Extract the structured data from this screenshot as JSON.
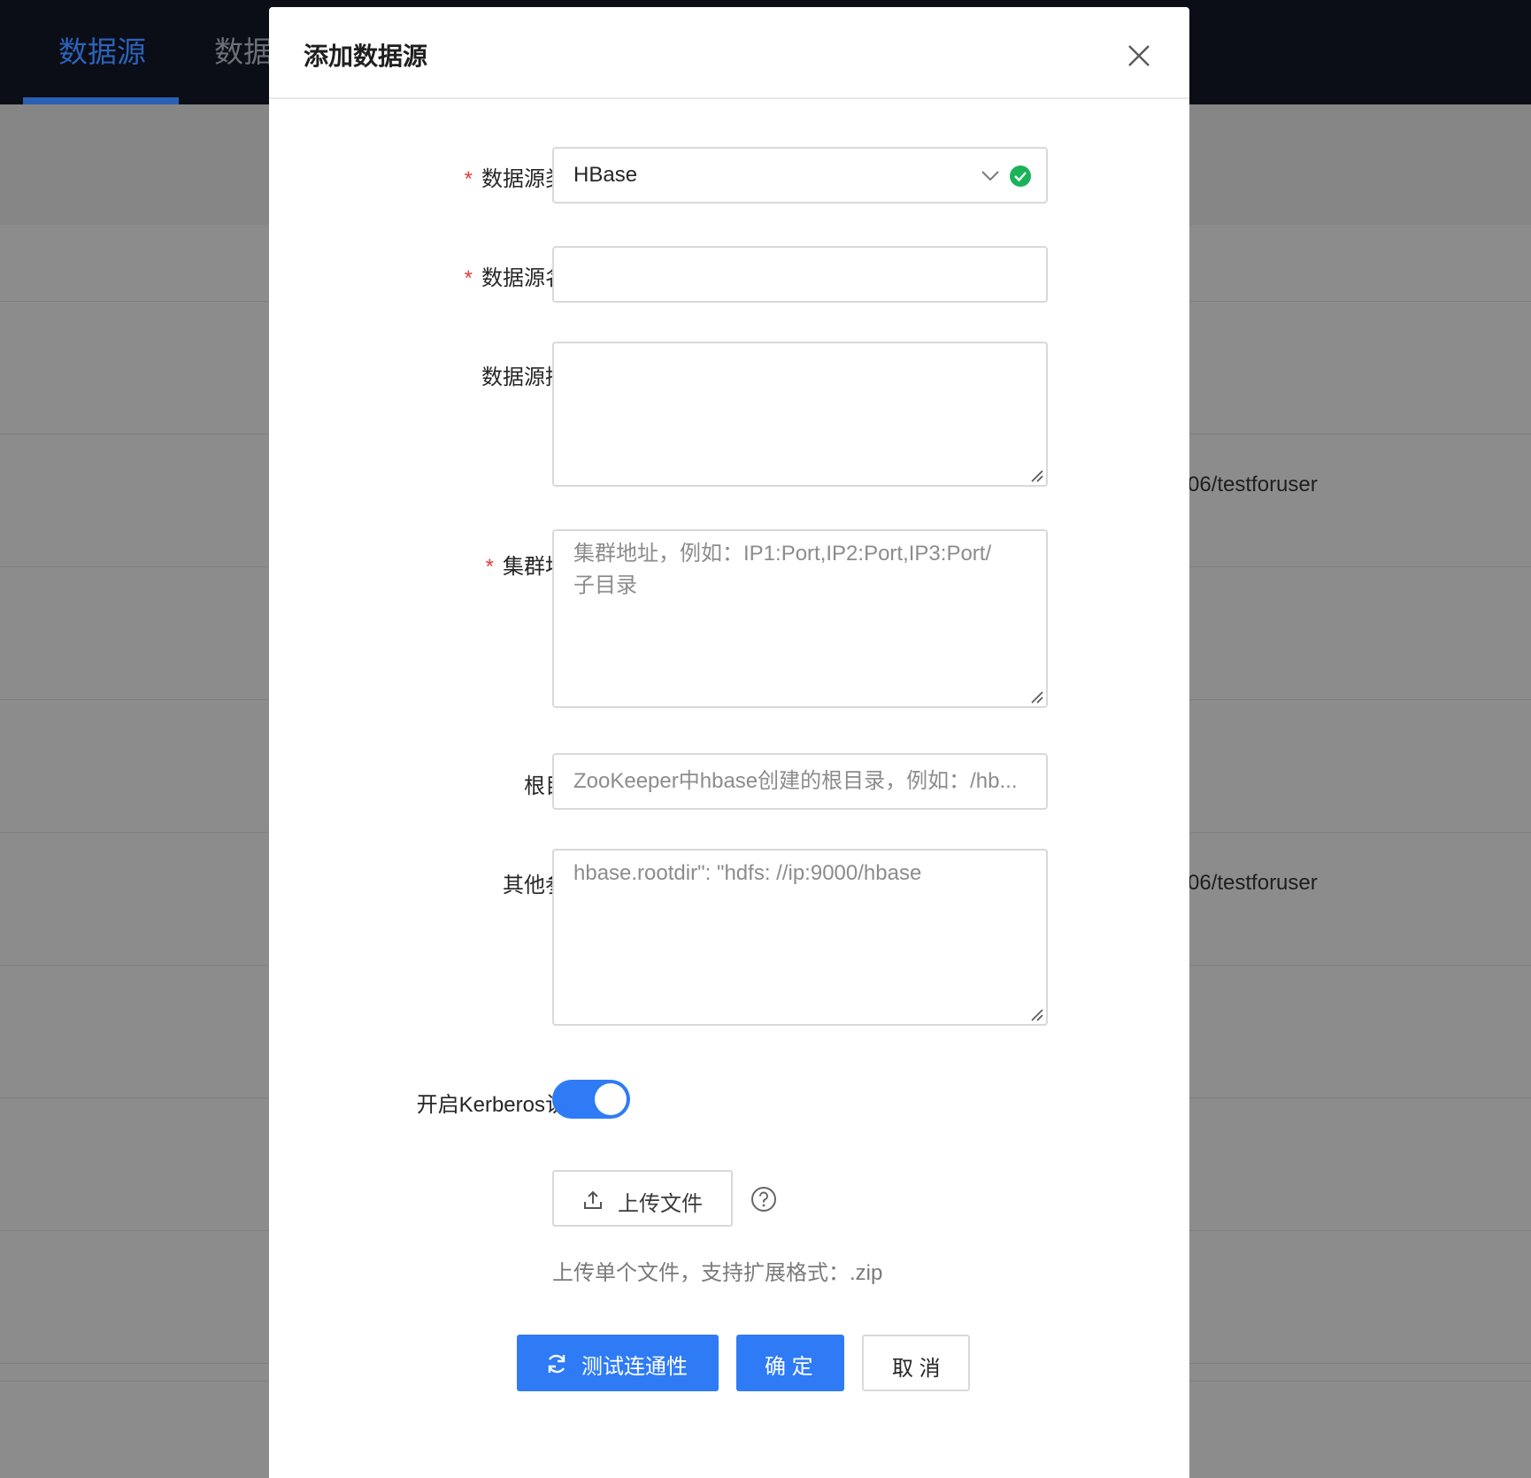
{
  "background": {
    "nav_tabs": [
      "数据源",
      "数据"
    ],
    "row_text_1": "06/testforuser",
    "row_text_2": "06/testforuser"
  },
  "modal": {
    "title": "添加数据源",
    "fields": {
      "type": {
        "label": "数据源类型：",
        "required": "*",
        "value": "HBase"
      },
      "name": {
        "label": "数据源名称：",
        "required": "*",
        "value": ""
      },
      "desc": {
        "label": "数据源描述：",
        "value": ""
      },
      "cluster": {
        "label": "集群地址：",
        "required": "*",
        "placeholder_line1": "集群地址，例如：IP1:Port,IP2:Port,IP3:Port/",
        "placeholder_line2": "子目录"
      },
      "root": {
        "label": "根目录：",
        "placeholder": "ZooKeeper中hbase创建的根目录，例如：/hb..."
      },
      "params": {
        "label": "其他参数：",
        "placeholder": "hbase.rootdir\": \"hdfs: //ip:9000/hbase"
      },
      "kerberos": {
        "label": "开启Kerberos认证：",
        "enabled": true
      }
    },
    "upload": {
      "button_label": "上传文件",
      "hint": "上传单个文件，支持扩展格式：.zip"
    },
    "buttons": {
      "test": "测试连通性",
      "confirm": "确 定",
      "cancel": "取 消"
    }
  },
  "colors": {
    "primary": "#2f7bf5",
    "success": "#1ab359",
    "required": "#e23c39",
    "nav_bg": "#0b0d17"
  }
}
